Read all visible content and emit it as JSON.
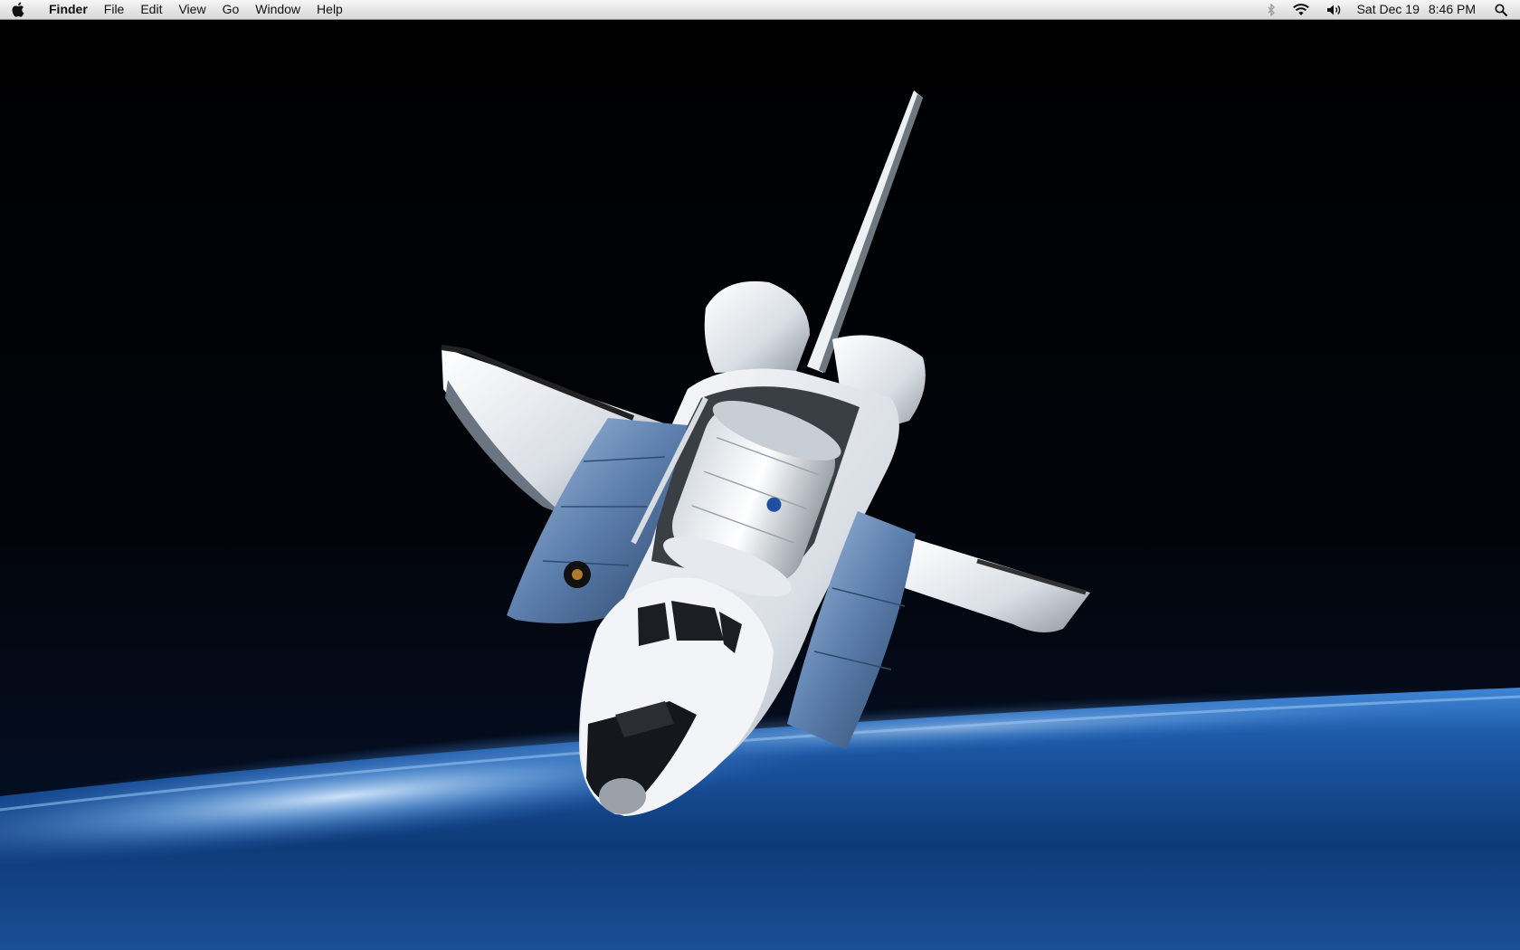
{
  "menubar": {
    "apple_icon": "apple-logo-icon",
    "app_name": "Finder",
    "menus": [
      "File",
      "Edit",
      "View",
      "Go",
      "Window",
      "Help"
    ],
    "status_icons": [
      "bluetooth-icon",
      "wifi-icon",
      "volume-icon"
    ],
    "clock": {
      "date": "Sat Dec 19",
      "time": "8:46 PM"
    },
    "spotlight_icon": "spotlight-search-icon"
  },
  "wallpaper": {
    "subject": "space-shuttle-orbit",
    "colors": {
      "space": "#000000",
      "atmosphere_glow": "#4f8fd8",
      "earth": "#0f3b7a",
      "hull": "#e9edf2",
      "tiles": "#1a1a1a"
    }
  }
}
